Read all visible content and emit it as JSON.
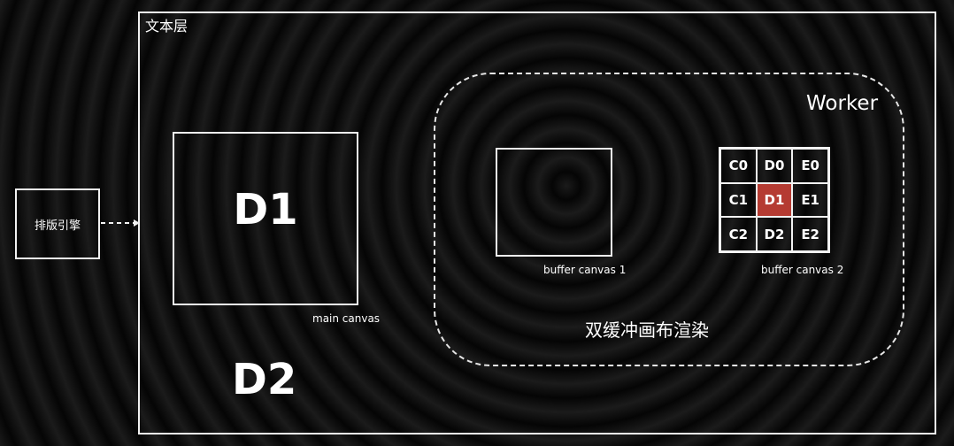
{
  "text_layer": {
    "label": "文本层"
  },
  "layout_engine": {
    "label": "排版引擎"
  },
  "main_canvas": {
    "content": "D1",
    "label": "main canvas"
  },
  "below_canvas": {
    "content": "D2"
  },
  "worker": {
    "label": "Worker",
    "caption": "双缓冲画布渲染"
  },
  "buffer_canvas_1": {
    "label": "buffer canvas 1"
  },
  "buffer_canvas_2": {
    "label": "buffer canvas 2",
    "tiles": [
      "C0",
      "D0",
      "E0",
      "C1",
      "D1",
      "E1",
      "C2",
      "D2",
      "E2"
    ],
    "highlighted": "D1",
    "highlight_color": "#b53b32"
  }
}
